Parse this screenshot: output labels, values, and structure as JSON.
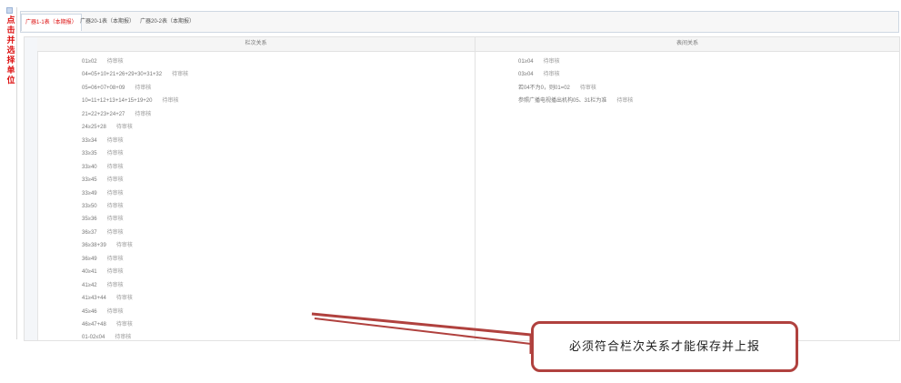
{
  "sidebar": {
    "question_label": "?",
    "vertical_text": [
      "点",
      "击",
      "并",
      "选",
      "择",
      "单",
      "位"
    ]
  },
  "tabs": [
    {
      "label": "广器1-1表（本期报）",
      "active": true
    },
    {
      "label": "广器20-1表（本期报）",
      "active": false
    },
    {
      "label": "广器20-2表（本期报）",
      "active": false
    }
  ],
  "left_panel": {
    "header": "栏次关系",
    "rows": [
      {
        "formula": "01≥02",
        "status": "待审核"
      },
      {
        "formula": "04=05+10+21+26+29+30+31+32",
        "status": "待审核"
      },
      {
        "formula": "05=06+07+08+09",
        "status": "待审核"
      },
      {
        "formula": "10=11+12+13+14+15+19+20",
        "status": "待审核"
      },
      {
        "formula": "21=22+23+24+27",
        "status": "待审核"
      },
      {
        "formula": "24≥25+28",
        "status": "待审核"
      },
      {
        "formula": "33≥34",
        "status": "待审核"
      },
      {
        "formula": "33≥35",
        "status": "待审核"
      },
      {
        "formula": "33≥40",
        "status": "待审核"
      },
      {
        "formula": "33≥45",
        "status": "待审核"
      },
      {
        "formula": "33≥49",
        "status": "待审核"
      },
      {
        "formula": "33≥50",
        "status": "待审核"
      },
      {
        "formula": "35≥36",
        "status": "待审核"
      },
      {
        "formula": "36≥37",
        "status": "待审核"
      },
      {
        "formula": "36≥38+39",
        "status": "待审核"
      },
      {
        "formula": "36≥49",
        "status": "待审核"
      },
      {
        "formula": "40≥41",
        "status": "待审核"
      },
      {
        "formula": "41≥42",
        "status": "待审核"
      },
      {
        "formula": "41≥43+44",
        "status": "待审核"
      },
      {
        "formula": "45≥46",
        "status": "待审核"
      },
      {
        "formula": "46≥47+48",
        "status": "待审核"
      },
      {
        "formula": "01-02≤04",
        "status": "待审核"
      }
    ]
  },
  "right_panel": {
    "header": "表间关系",
    "rows": [
      {
        "formula": "01≥04",
        "status": "待审核"
      },
      {
        "formula": "03≥04",
        "status": "待审核"
      },
      {
        "formula": "若04不为0，则01=02",
        "status": "待审核"
      },
      {
        "formula": "参照广播电视播出机构05、31栏为准",
        "status": "待审核"
      }
    ]
  },
  "callout": {
    "text": "必须符合栏次关系才能保存并上报",
    "border_color": "#b0413e"
  },
  "colors": {
    "active_tab": "#dd1111",
    "sidebar_text": "#dd1111",
    "arrow": "#b0413e"
  }
}
